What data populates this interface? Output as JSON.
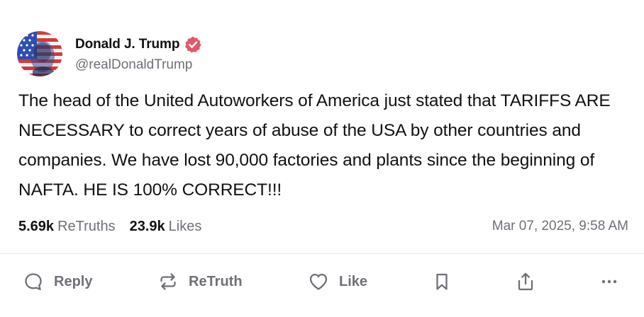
{
  "author": {
    "display_name": "Donald J. Trump",
    "handle": "@realDonaldTrump",
    "verified": true,
    "verified_color": "#e5566a",
    "avatar_icon": "avatar-flag-portrait"
  },
  "post": {
    "text": "The head of the United Autoworkers of America just stated that TARIFFS ARE NECESSARY to correct years of abuse of the USA by other countries and companies. We have lost 90,000 factories and plants since the beginning of NAFTA. HE IS 100% CORRECT!!!"
  },
  "stats": {
    "retruths_count": "5.69k",
    "retruths_label": "ReTruths",
    "likes_count": "23.9k",
    "likes_label": "Likes",
    "timestamp": "Mar 07, 2025, 9:58 AM"
  },
  "actions": {
    "reply_label": "Reply",
    "retruth_label": "ReTruth",
    "like_label": "Like",
    "bookmark_icon": "bookmark-icon",
    "share_icon": "share-icon",
    "more_icon": "more-icon"
  },
  "colors": {
    "text": "#111111",
    "muted": "#6f6f78",
    "divider": "#e8e8ec"
  }
}
